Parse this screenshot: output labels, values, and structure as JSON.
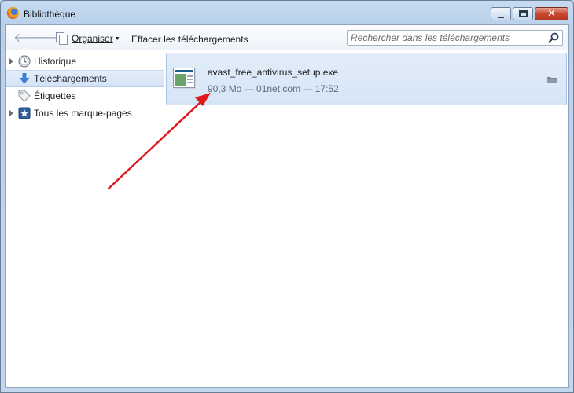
{
  "window": {
    "title": "Bibliothèque",
    "close_glyph": "✕"
  },
  "toolbar": {
    "back_glyph": "🡐",
    "forward_glyph": "🡒",
    "organize_label": "Organiser",
    "organize_caret": "▼",
    "clear_label": "Effacer les téléchargements",
    "search_placeholder": "Rechercher dans les téléchargements"
  },
  "sidebar": {
    "items": [
      {
        "label": "Historique",
        "icon": "clock-icon",
        "expandable": true
      },
      {
        "label": "Téléchargements",
        "icon": "download-arrow-icon",
        "expandable": false,
        "selected": true
      },
      {
        "label": "Étiquettes",
        "icon": "tag-icon",
        "expandable": false
      },
      {
        "label": "Tous les marque-pages",
        "icon": "star-bookmark-icon",
        "expandable": true
      }
    ]
  },
  "downloads": [
    {
      "file_name": "avast_free_antivirus_setup.exe",
      "meta": "90,3 Mo — 01net.com — 17:52",
      "icon": "executable-file-icon",
      "action_icon": "folder-icon"
    }
  ],
  "colors": {
    "selection": "#d6e5f6",
    "annotation_arrow": "#e0171c",
    "accent": "#3b7fd1"
  }
}
